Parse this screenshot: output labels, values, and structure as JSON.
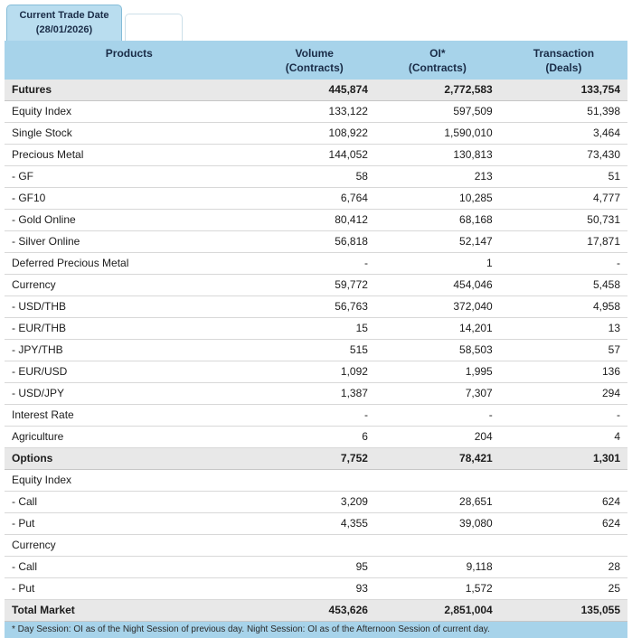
{
  "colors": {
    "header-bg": "#a7d3ea",
    "tab-bg": "#b9ddef",
    "tab-border": "#85bcd8",
    "section-bg": "#e8e8e8",
    "row-border": "#d8d8d8",
    "text": "#1c1c1c",
    "header-text": "#1a2c47",
    "footnote-bg": "#a7d3ea"
  },
  "tab": {
    "line1": "Current Trade Date",
    "line2": "(28/01/2026)"
  },
  "table": {
    "headers": [
      {
        "label": "Products",
        "sub": ""
      },
      {
        "label": "Volume",
        "sub": "(Contracts)"
      },
      {
        "label": "OI*",
        "sub": "(Contracts)"
      },
      {
        "label": "Transaction",
        "sub": "(Deals)"
      }
    ],
    "rows": [
      {
        "product": "Futures",
        "volume": "445,874",
        "oi": "2,772,583",
        "transaction": "133,754",
        "style": "section"
      },
      {
        "product": "Equity Index",
        "volume": "133,122",
        "oi": "597,509",
        "transaction": "51,398",
        "style": ""
      },
      {
        "product": "Single Stock",
        "volume": "108,922",
        "oi": "1,590,010",
        "transaction": "3,464",
        "style": ""
      },
      {
        "product": "Precious Metal",
        "volume": "144,052",
        "oi": "130,813",
        "transaction": "73,430",
        "style": ""
      },
      {
        "product": "- GF",
        "volume": "58",
        "oi": "213",
        "transaction": "51",
        "style": ""
      },
      {
        "product": "- GF10",
        "volume": "6,764",
        "oi": "10,285",
        "transaction": "4,777",
        "style": ""
      },
      {
        "product": "- Gold Online",
        "volume": "80,412",
        "oi": "68,168",
        "transaction": "50,731",
        "style": ""
      },
      {
        "product": "- Silver Online",
        "volume": "56,818",
        "oi": "52,147",
        "transaction": "17,871",
        "style": ""
      },
      {
        "product": "Deferred Precious Metal",
        "volume": "-",
        "oi": "1",
        "transaction": "-",
        "style": ""
      },
      {
        "product": "Currency",
        "volume": "59,772",
        "oi": "454,046",
        "transaction": "5,458",
        "style": ""
      },
      {
        "product": "- USD/THB",
        "volume": "56,763",
        "oi": "372,040",
        "transaction": "4,958",
        "style": ""
      },
      {
        "product": "- EUR/THB",
        "volume": "15",
        "oi": "14,201",
        "transaction": "13",
        "style": ""
      },
      {
        "product": "- JPY/THB",
        "volume": "515",
        "oi": "58,503",
        "transaction": "57",
        "style": ""
      },
      {
        "product": "- EUR/USD",
        "volume": "1,092",
        "oi": "1,995",
        "transaction": "136",
        "style": ""
      },
      {
        "product": "- USD/JPY",
        "volume": "1,387",
        "oi": "7,307",
        "transaction": "294",
        "style": ""
      },
      {
        "product": "Interest Rate",
        "volume": "-",
        "oi": "-",
        "transaction": "-",
        "style": ""
      },
      {
        "product": "Agriculture",
        "volume": "6",
        "oi": "204",
        "transaction": "4",
        "style": ""
      },
      {
        "product": "Options",
        "volume": "7,752",
        "oi": "78,421",
        "transaction": "1,301",
        "style": "section"
      },
      {
        "product": "Equity Index",
        "volume": "",
        "oi": "",
        "transaction": "",
        "style": ""
      },
      {
        "product": "- Call",
        "volume": "3,209",
        "oi": "28,651",
        "transaction": "624",
        "style": ""
      },
      {
        "product": "- Put",
        "volume": "4,355",
        "oi": "39,080",
        "transaction": "624",
        "style": ""
      },
      {
        "product": "Currency",
        "volume": "",
        "oi": "",
        "transaction": "",
        "style": ""
      },
      {
        "product": "- Call",
        "volume": "95",
        "oi": "9,118",
        "transaction": "28",
        "style": ""
      },
      {
        "product": "- Put",
        "volume": "93",
        "oi": "1,572",
        "transaction": "25",
        "style": ""
      },
      {
        "product": "Total Market",
        "volume": "453,626",
        "oi": "2,851,004",
        "transaction": "135,055",
        "style": "section"
      }
    ]
  },
  "footnote": "* Day Session: OI as of the Night Session of previous day. Night Session: OI as of the Afternoon Session of current day."
}
